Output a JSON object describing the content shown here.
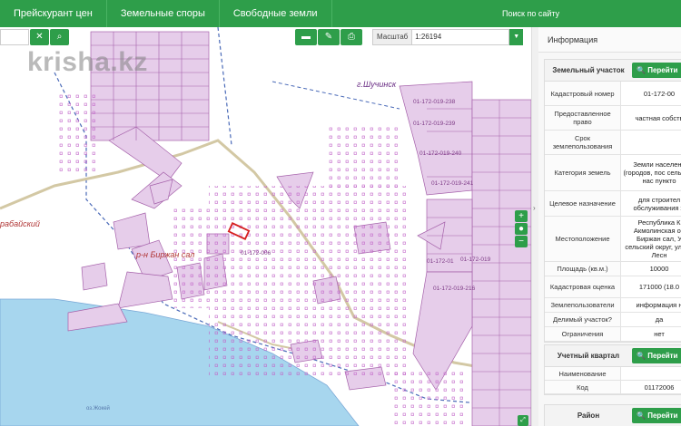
{
  "topnav": {
    "price_label": "Прейскурант цен",
    "disputes_label": "Земельные споры",
    "free_label": "Свободные земли",
    "search_label": "Поиск по сайту"
  },
  "map": {
    "scale_label": "Масштаб",
    "scale_value": "1:26194",
    "watermark": "krisha.kz",
    "labels": {
      "town": "г.Шучинск",
      "district": "р-н Биржан сал",
      "area_left": "рабайский",
      "lake": "оз.Жокей",
      "p1": "01-172-019-238",
      "p2": "01-172-019-239",
      "p3": "01-172-019-240",
      "p4": "01-172-019-241",
      "p5": "01-172-006",
      "p6": "01-172-019",
      "p7": "01-172-019-216",
      "p8": "01-172-01"
    }
  },
  "panel": {
    "title": "Информация",
    "land": {
      "title": "Земельный участок",
      "goto_label": "Перейти",
      "rows": [
        {
          "k": "Кадастровый номер",
          "v": "01-172-00"
        },
        {
          "k": "Предоставленное право",
          "v": "частная собств"
        },
        {
          "k": "Срок землепользования",
          "v": ""
        },
        {
          "k": "Категория земель",
          "v": "Земли населенн (городов, пос сельских нас пункто"
        },
        {
          "k": "Целевое назначение",
          "v": "для строител обслуживания ж"
        },
        {
          "k": "Местоположение",
          "v": "Республика К Акмолинская об Биржан сал, У сельский округ, улица Лесн"
        },
        {
          "k": "Площадь (кв.м.)",
          "v": "10000"
        },
        {
          "k": "Кадастровая оценка",
          "v": "171000 (18.0"
        },
        {
          "k": "Землепользователи",
          "v": "информация н"
        },
        {
          "k": "Делимый участок?",
          "v": "да"
        },
        {
          "k": "Ограничения",
          "v": "нет"
        }
      ]
    },
    "quarter": {
      "title": "Учетный квартал",
      "goto_label": "Перейти",
      "rows": [
        {
          "k": "Наименование",
          "v": ""
        },
        {
          "k": "Код",
          "v": "01172006"
        }
      ]
    },
    "district": {
      "title": "Район",
      "goto_label": "Перейти"
    }
  }
}
